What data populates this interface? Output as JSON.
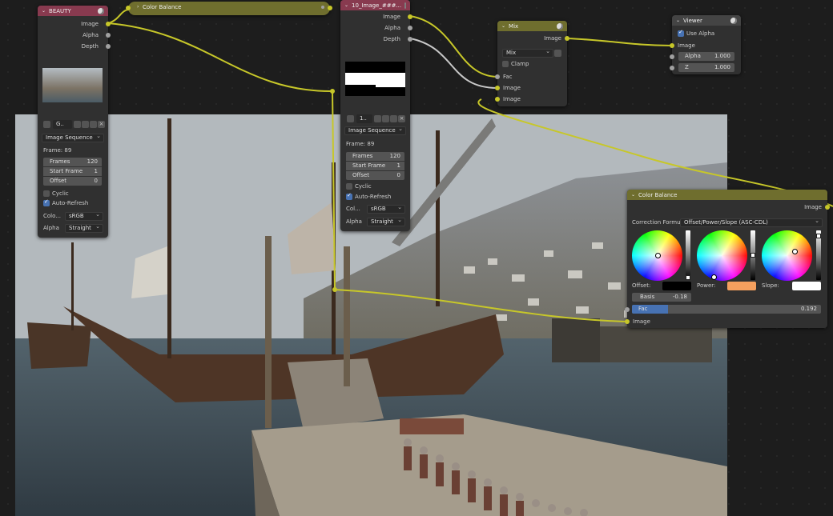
{
  "beauty": {
    "title": "BEAUTY",
    "out_image": "Image",
    "out_alpha": "Alpha",
    "out_depth": "Depth",
    "file_name": "G..",
    "source": "Image Sequence",
    "frame": "Frame: 89",
    "frames_label": "Frames",
    "frames_value": "120",
    "start_label": "Start Frame",
    "start_value": "1",
    "offset_label": "Offset",
    "offset_value": "0",
    "cyclic_label": "Cyclic",
    "autorefresh_label": "Auto-Refresh",
    "colorspace_label": "Colo...",
    "colorspace_value": "sRGB",
    "alpha_label": "Alpha",
    "alpha_value": "Straight"
  },
  "color_balance_collapsed": {
    "title": "Color Balance"
  },
  "image_seq": {
    "title": "10_Image_###...",
    "out_image": "Image",
    "out_alpha": "Alpha",
    "out_depth": "Depth",
    "file_name": "1..",
    "source": "Image Sequence",
    "frame": "Frame: 89",
    "frames_label": "Frames",
    "frames_value": "120",
    "start_label": "Start Frame",
    "start_value": "1",
    "offset_label": "Offset",
    "offset_value": "0",
    "cyclic_label": "Cyclic",
    "autorefresh_label": "Auto-Refresh",
    "colorspace_label": "Col...",
    "colorspace_value": "sRGB",
    "alpha_label": "Alpha",
    "alpha_value": "Straight"
  },
  "mix": {
    "title": "Mix",
    "out_image": "Image",
    "blend_mode": "Mix",
    "clamp_label": "Clamp",
    "fac_label": "Fac",
    "in_image1": "Image",
    "in_image2": "Image"
  },
  "viewer": {
    "title": "Viewer",
    "use_alpha_label": "Use Alpha",
    "in_image": "Image",
    "alpha_label": "Alpha",
    "alpha_value": "1.000",
    "z_label": "Z",
    "z_value": "1.000"
  },
  "color_balance": {
    "title": "Color Balance",
    "out_image": "Image",
    "formula_label": "Correction Formu...",
    "formula_value": "Offset/Power/Slope (ASC-CDL)",
    "offset_label": "Offset:",
    "power_label": "Power:",
    "slope_label": "Slope:",
    "basis_label": "Basis",
    "basis_value": "-0.18",
    "fac_label": "Fac",
    "fac_value": "0.192",
    "fac_fraction": 0.192,
    "in_image": "Image"
  },
  "colors": {
    "image_header": "#883a4f",
    "color_header": "#6f6e2e",
    "link_color": "#c7c729",
    "power_swatch": "#f5a05e",
    "slope_swatch": "#ffffff",
    "offset_swatch": "#000000",
    "fac_bar": "#4772b3"
  }
}
